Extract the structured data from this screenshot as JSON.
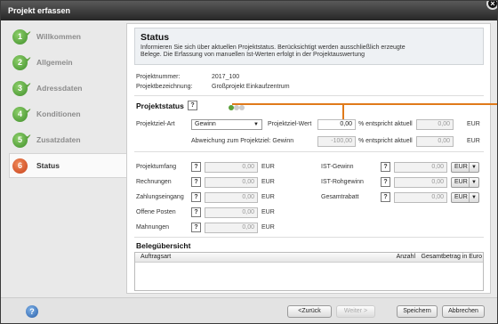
{
  "window": {
    "title": "Projekt erfassen"
  },
  "sidebar": {
    "steps": [
      {
        "num": "1",
        "label": "Willkommen"
      },
      {
        "num": "2",
        "label": "Allgemein"
      },
      {
        "num": "3",
        "label": "Adressdaten"
      },
      {
        "num": "4",
        "label": "Konditionen"
      },
      {
        "num": "5",
        "label": "Zusatzdaten"
      },
      {
        "num": "6",
        "label": "Status"
      }
    ]
  },
  "header": {
    "title": "Status",
    "desc1": "Informieren Sie sich über aktuellen Projektstatus. Berücksichtigt werden ausschließlich erzeugte",
    "desc2": "Belege. Die Erfassung von manuellen Ist-Werten erfolgt in der Projektauswertung"
  },
  "info": {
    "nr_label": "Projektnummer:",
    "nr_value": "2017_100",
    "bez_label": "Projektbezeichnung:",
    "bez_value": "Großprojekt Einkaufzentrum"
  },
  "status": {
    "title": "Projektstatus",
    "ziel_art_label": "Projektziel-Art",
    "ziel_art_value": "Gewinn",
    "ziel_wert_label": "Projektziel-Wert",
    "ziel_wert_value": "0,00",
    "entspricht": "% entspricht aktuell",
    "aktuell_value": "0,00",
    "currency": "EUR",
    "abw_label": "Abweichung zum Projektziel: Gewinn",
    "abw_value": "-100,00",
    "abw_aktuell": "0,00"
  },
  "left": {
    "rows": [
      {
        "label": "Projektumfang",
        "value": "0,00",
        "currency": "EUR"
      },
      {
        "label": "Rechnungen",
        "value": "0,00",
        "currency": "EUR"
      },
      {
        "label": "Zahlungseingang",
        "value": "0,00",
        "currency": "EUR"
      },
      {
        "label": "Offene Posten",
        "value": "0,00",
        "currency": "EUR"
      },
      {
        "label": "Mahnungen",
        "value": "0,00",
        "currency": "EUR"
      }
    ]
  },
  "right": {
    "rows": [
      {
        "label": "IST-Gewinn",
        "value": "0,00",
        "currency": "EUR"
      },
      {
        "label": "IST-Rohgewinn",
        "value": "0,00",
        "currency": "EUR"
      },
      {
        "label": "Gesamtrabatt",
        "value": "0,00",
        "currency": "EUR"
      }
    ]
  },
  "belege": {
    "title": "Belegübersicht",
    "columns": [
      "Auftragsart",
      "Anzahl",
      "Gesamtbetrag in Euro"
    ]
  },
  "footer": {
    "back": "<Zurück",
    "next": "Weiter >",
    "save": "Speichern",
    "cancel": "Abbrechen",
    "help": "?"
  },
  "colors": {
    "accent": "#e07a1a",
    "green": "#3f8e2a",
    "active": "#c8421b"
  }
}
